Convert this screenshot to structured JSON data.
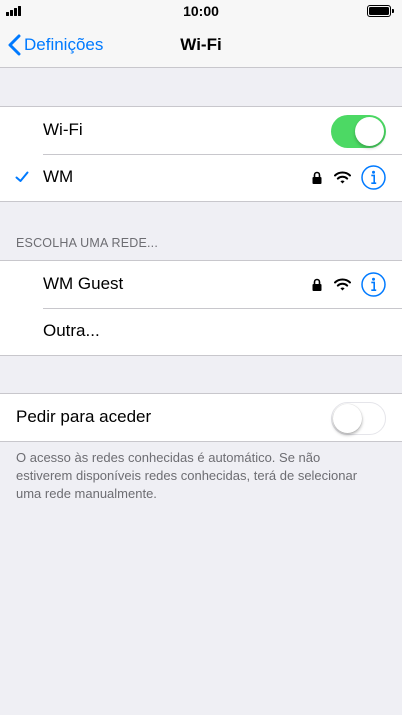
{
  "status_bar": {
    "time": "10:00",
    "battery_level": 1.0
  },
  "nav": {
    "back_label": "Definições",
    "title": "Wi-Fi"
  },
  "wifi_group": {
    "wifi_label": "Wi-Fi",
    "wifi_toggle_on": true,
    "connected_network": {
      "name": "WM",
      "secured": true,
      "selected": true
    }
  },
  "networks_section": {
    "header": "ESCOLHA UMA REDE...",
    "networks": [
      {
        "name": "WM Guest",
        "secured": true
      }
    ],
    "other_label": "Outra..."
  },
  "ask_group": {
    "label": "Pedir para aceder",
    "toggle_on": false,
    "footer": "O acesso às redes conhecidas é automático. Se não estiverem disponíveis redes conhecidas, terá de selecionar uma rede manualmente."
  },
  "colors": {
    "accent": "#007aff",
    "toggle_on": "#4cd964",
    "background": "#efeff4"
  },
  "icons": [
    "signal-icon",
    "battery-icon",
    "chevron-left-icon",
    "checkmark-icon",
    "lock-icon",
    "wifi-icon",
    "info-icon"
  ]
}
